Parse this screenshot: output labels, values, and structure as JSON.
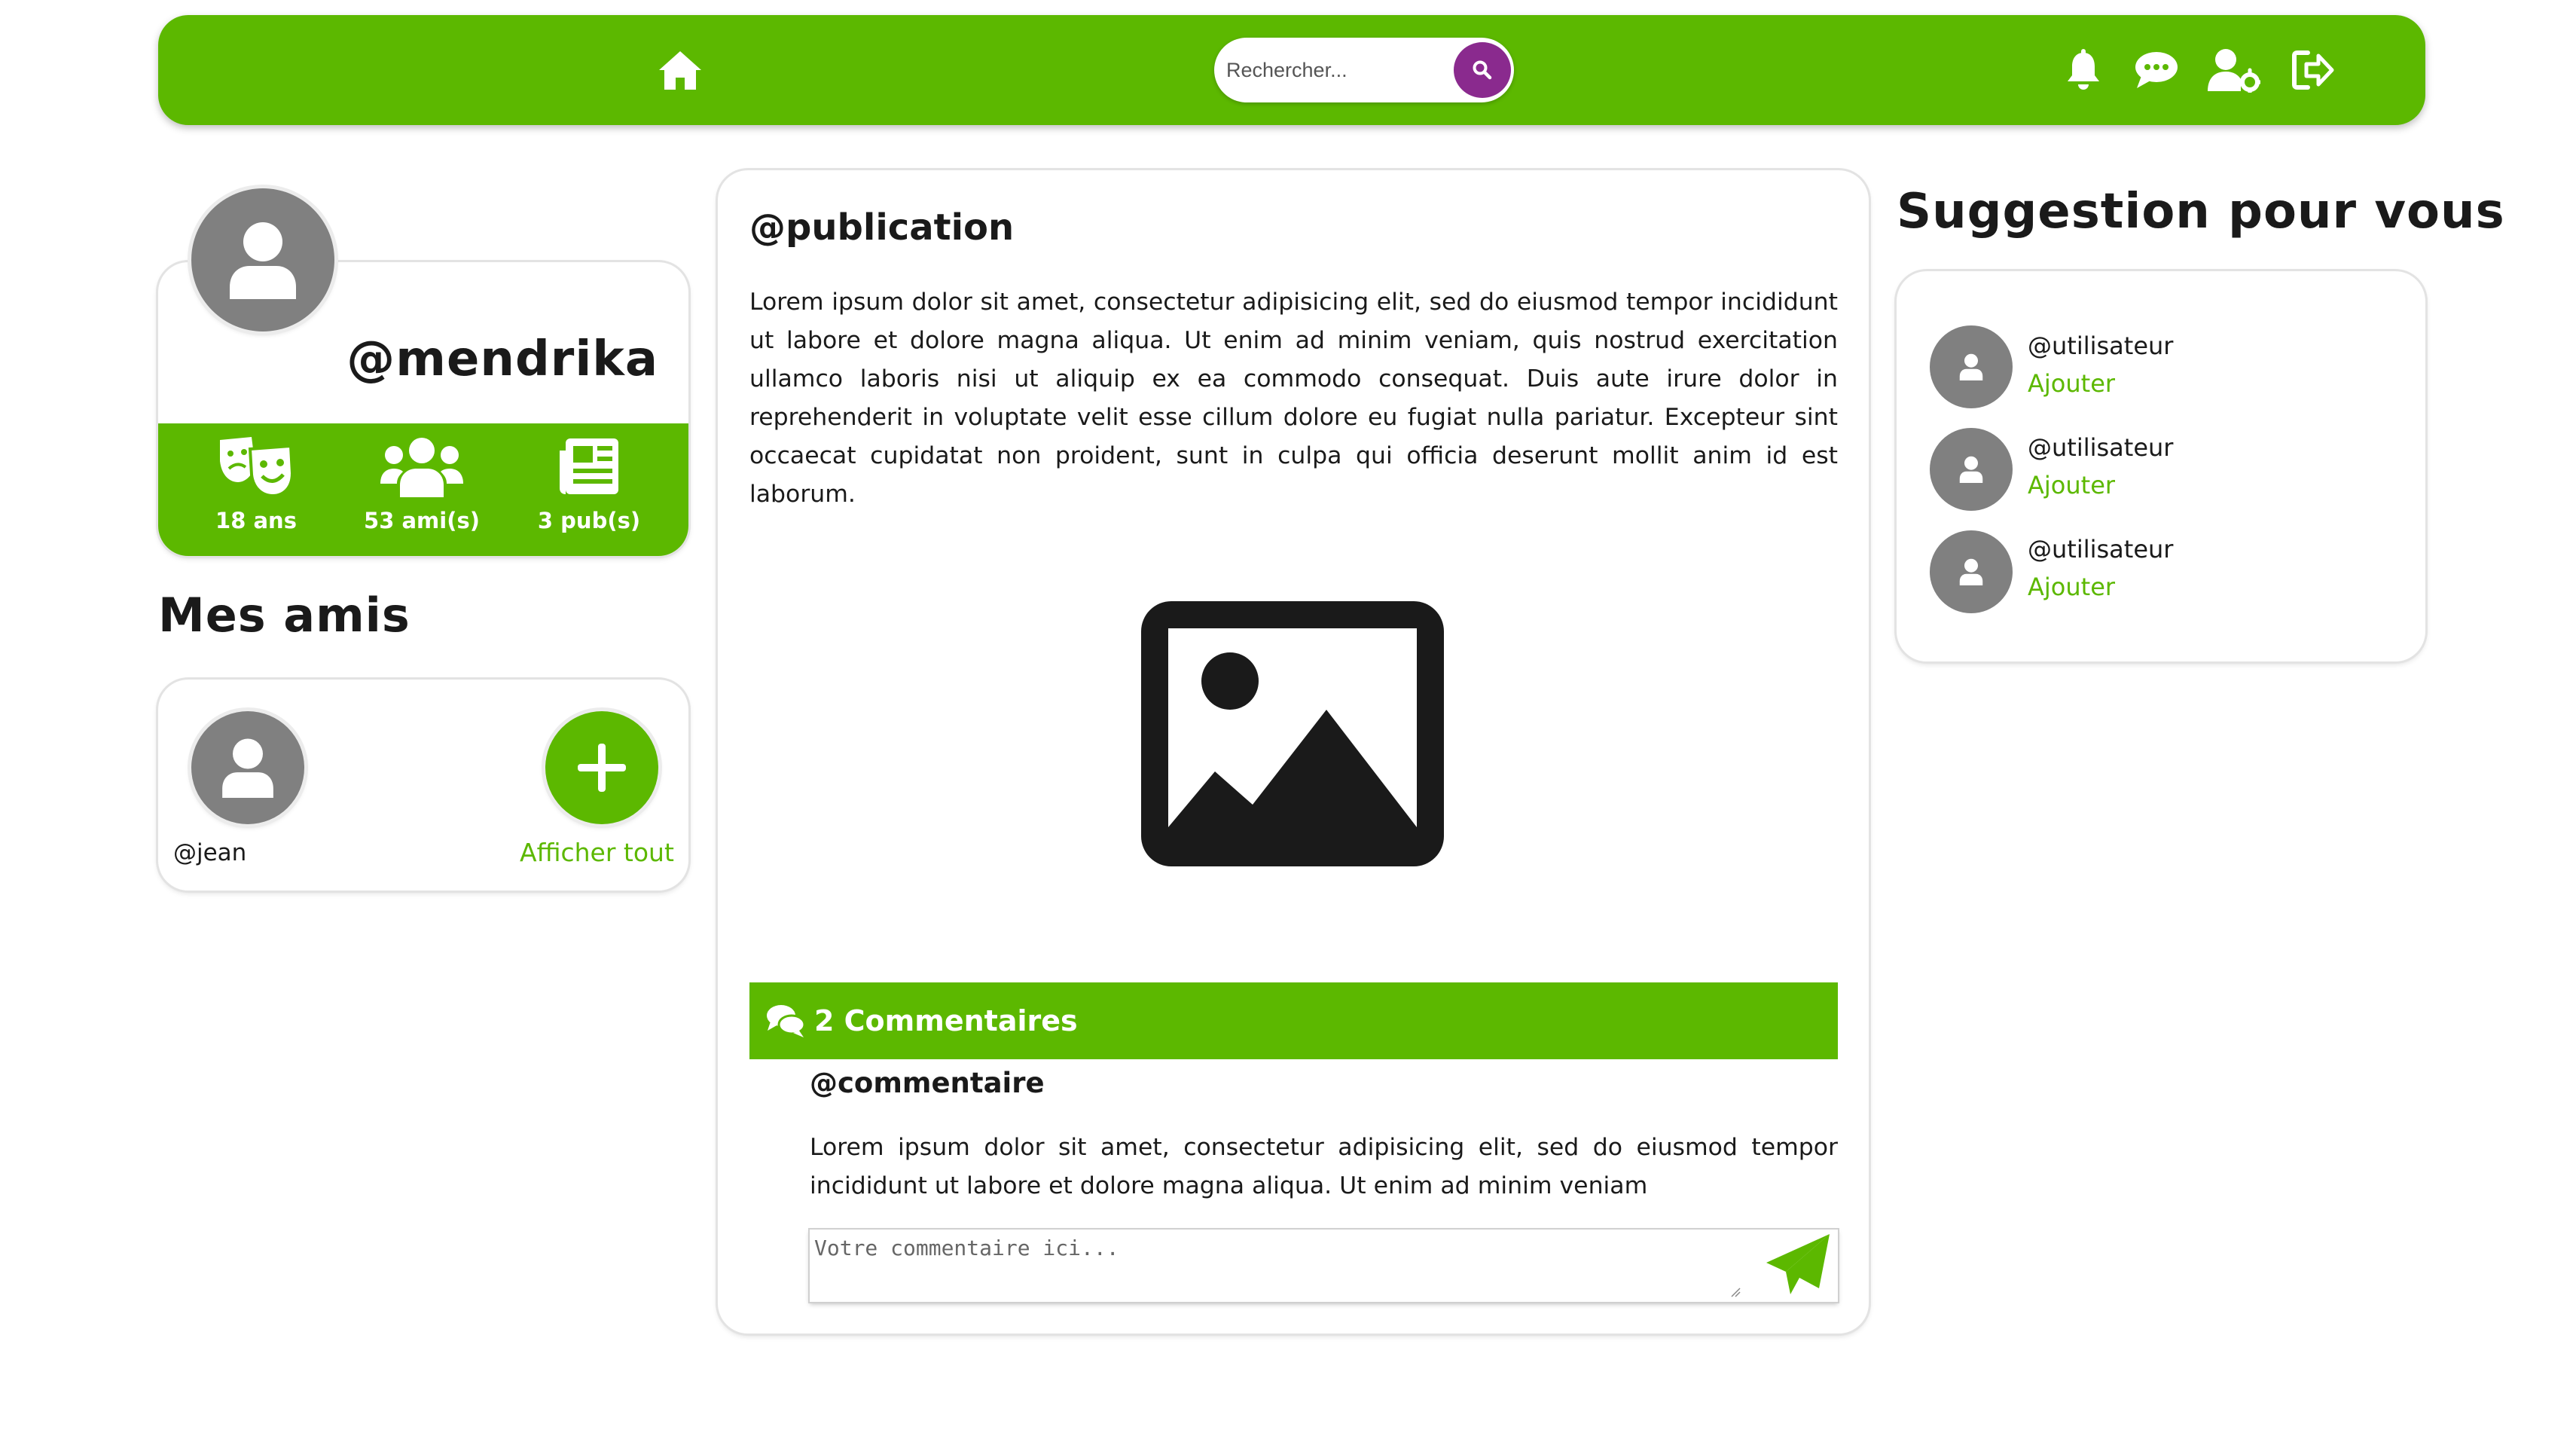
{
  "nav": {
    "home_icon": "home-icon",
    "search": {
      "placeholder": "Rechercher...",
      "button_icon": "search-icon"
    },
    "right_icons": [
      "bell-icon",
      "chat-icon",
      "user-settings-icon",
      "logout-icon"
    ]
  },
  "profile": {
    "username": "@mendrika",
    "stats": [
      {
        "icon": "theater-masks-icon",
        "label": "18 ans"
      },
      {
        "icon": "users-icon",
        "label": "53 ami(s)"
      },
      {
        "icon": "newspaper-icon",
        "label": "3 pub(s)"
      }
    ]
  },
  "friends": {
    "title": "Mes amis",
    "list": [
      {
        "name": "@jean"
      }
    ],
    "show_all_label": "Afficher tout"
  },
  "post": {
    "title": "@publication",
    "body": "Lorem ipsum dolor sit amet, consectetur adipisicing elit, sed do eiusmod tempor incididunt ut labore et dolore magna aliqua. Ut enim ad minim veniam, quis nostrud exercitation ullamco laboris nisi ut aliquip ex ea commodo consequat. Duis aute irure dolor in reprehenderit in voluptate velit esse cillum dolore eu fugiat nulla pariatur. Excepteur sint occaecat cupidatat non proident, sunt in culpa qui officia deserunt mollit anim id est laborum.",
    "image_icon": "image-placeholder-icon",
    "comments_label": "2 Commentaires",
    "comment": {
      "author": "@commentaire",
      "body": "Lorem ipsum dolor sit amet, consectetur adipisicing elit, sed do eiusmod tempor incididunt ut labore et dolore magna aliqua. Ut enim ad minim veniam"
    },
    "comment_input": {
      "placeholder": "Votre commentaire ici..."
    },
    "send_icon": "paper-plane-icon"
  },
  "suggestions": {
    "title": "Suggestion pour vous",
    "items": [
      {
        "name": "@utilisateur",
        "action": "Ajouter"
      },
      {
        "name": "@utilisateur",
        "action": "Ajouter"
      },
      {
        "name": "@utilisateur",
        "action": "Ajouter"
      }
    ]
  },
  "colors": {
    "accent": "#5cb800",
    "search_button": "#8a2a8e",
    "avatar": "#808080"
  }
}
